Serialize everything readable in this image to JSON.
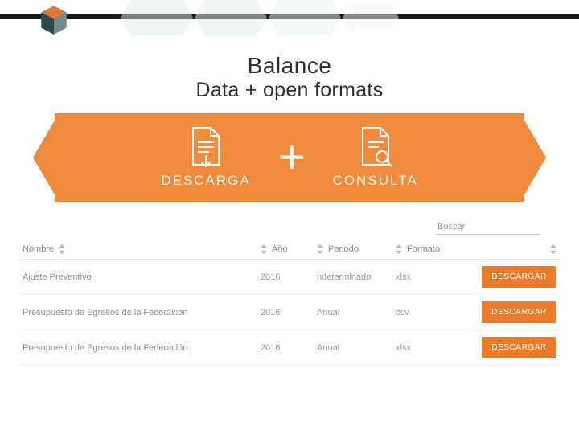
{
  "colors": {
    "accent": "#f08a3c",
    "button": "#ef7a2a"
  },
  "header": {
    "title_line1": "Balance",
    "title_line2": "Data + open formats"
  },
  "banner": {
    "left_label": "DESCARGA",
    "right_label": "CONSULTA",
    "plus": "+",
    "left_icon": "download-document-icon",
    "right_icon": "search-document-icon"
  },
  "search": {
    "placeholder": "Buscar"
  },
  "table": {
    "columns": {
      "nombre": "Nombre",
      "ano": "Año",
      "periodo": "Periodo",
      "formato": "Formato"
    },
    "rows": [
      {
        "nombre": "Ajuste Preventivo",
        "ano": "2016",
        "periodo": "ndeterminado",
        "formato": "xlsx",
        "btn": "DESCARGAR"
      },
      {
        "nombre": "Presupuesto de Egresos de la Federación",
        "ano": "2016",
        "periodo": "Anual",
        "formato": "csv",
        "btn": "DESCARGAR"
      },
      {
        "nombre": "Presupuesto de Egresos de la Federación",
        "ano": "2016",
        "periodo": "Anual",
        "formato": "xlsx",
        "btn": "DESCARGAR"
      }
    ]
  }
}
